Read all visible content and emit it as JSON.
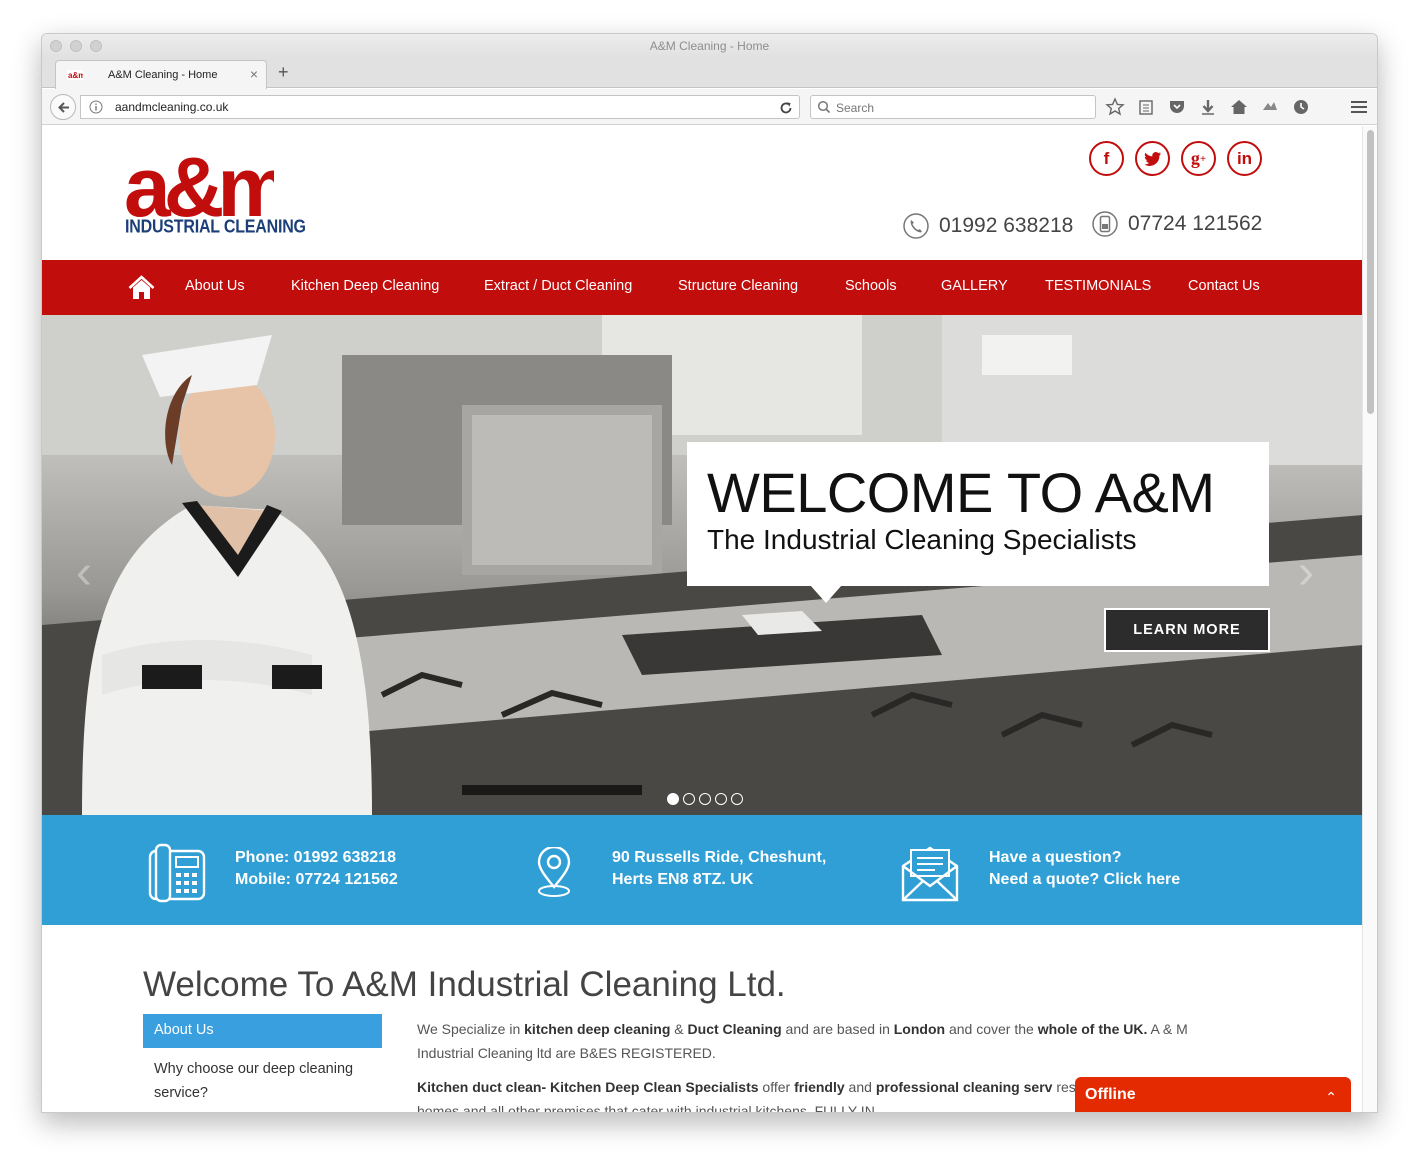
{
  "browser": {
    "window_title": "A&M Cleaning - Home",
    "tab_title": "A&M Cleaning - Home",
    "url": "aandmcleaning.co.uk",
    "search_placeholder": "Search"
  },
  "header": {
    "logo_text": "a&m",
    "logo_subtitle": "INDUSTRIAL CLEANING",
    "phone": "01992 638218",
    "mobile": "07724 121562",
    "socials": [
      {
        "name": "facebook",
        "glyph": "f"
      },
      {
        "name": "twitter",
        "glyph": "t"
      },
      {
        "name": "google-plus",
        "glyph": "g+"
      },
      {
        "name": "linkedin",
        "glyph": "in"
      }
    ]
  },
  "nav": {
    "items": [
      "About Us",
      "Kitchen Deep Cleaning",
      "Extract / Duct Cleaning",
      "Structure Cleaning",
      "Schools",
      "GALLERY",
      "TESTIMONIALS",
      "Contact Us"
    ]
  },
  "hero": {
    "title": "WELCOME TO A&M",
    "subtitle": "The Industrial Cleaning Specialists",
    "button": "LEARN MORE",
    "slides": 5,
    "active_slide": 1
  },
  "info": {
    "phone_line": "Phone:  01992 638218",
    "mobile_line": "Mobile:  07724 121562",
    "address_line1": "90 Russells Ride, Cheshunt,",
    "address_line2": "Herts EN8 8TZ. UK",
    "question_line": "Have a question?",
    "quote_line": "Need a quote? Click here"
  },
  "content": {
    "heading": "Welcome To A&M Industrial Cleaning Ltd.",
    "side_menu": [
      "About Us",
      "Why choose our deep cleaning service?"
    ],
    "p1": [
      {
        "t": "We Specialize in ",
        "b": false
      },
      {
        "t": "kitchen deep cleaning",
        "b": true
      },
      {
        "t": " & ",
        "b": false
      },
      {
        "t": "Duct Cleaning",
        "b": true
      },
      {
        "t": " and are based in ",
        "b": false
      },
      {
        "t": "London",
        "b": true
      },
      {
        "t": " and cover the ",
        "b": false
      },
      {
        "t": "whole of the UK.",
        "b": true
      },
      {
        "t": " A & M Industrial Cleaning ltd are B&ES REGISTERED.",
        "b": false
      }
    ],
    "p2": [
      {
        "t": "Kitchen duct clean- Kitchen Deep Clean Specialists",
        "b": true
      },
      {
        "t": " offer ",
        "b": false
      },
      {
        "t": "friendly",
        "b": true
      },
      {
        "t": " and ",
        "b": false
      },
      {
        "t": "professional cleaning serv",
        "b": true
      },
      {
        "t": " restaurants, hospitals, care homes and all other premises that cater with industrial kitchens ,FULLY IN",
        "b": false
      }
    ]
  },
  "chat": {
    "label": "Offline"
  },
  "colors": {
    "brand_red": "#c20d0d",
    "info_blue": "#2f9fd5",
    "side_blue": "#3a9fde",
    "chat_red": "#e32a00",
    "logo_blue": "#1d3f78"
  }
}
